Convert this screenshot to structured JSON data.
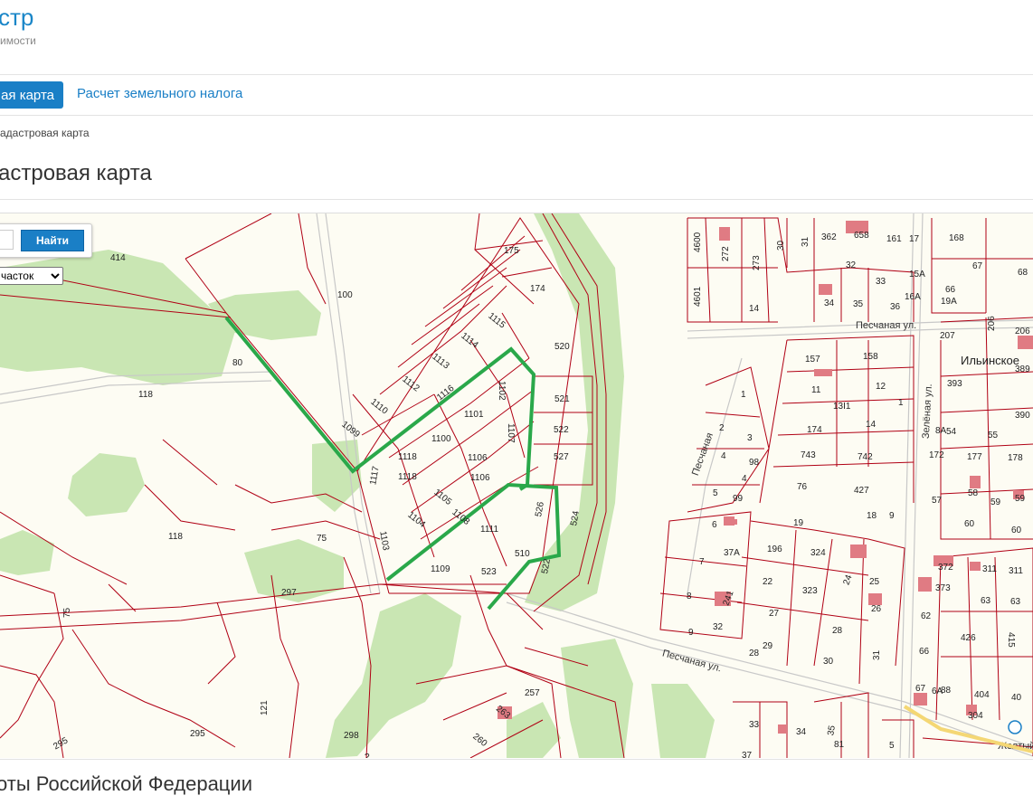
{
  "header": {
    "logo_title": "стр",
    "logo_subtitle": "имости"
  },
  "nav": {
    "active_tab": "ая карта",
    "link_tax": "Расчет земельного налога"
  },
  "breadcrumb": "адастровая карта",
  "page_title": "астровая карта",
  "map_controls": {
    "search_button": "Найти",
    "search_value": "",
    "type_select": "часток"
  },
  "map": {
    "streets": [
      "Песчаная ул.",
      "Песчаная ул.",
      "Зелёная ул.",
      "Песчаная"
    ],
    "place": "Ильинское",
    "transit": "Желтый",
    "parcels": [
      "175",
      "174",
      "100",
      "414",
      "80",
      "118",
      "118",
      "75",
      "297",
      "295",
      "121",
      "298",
      "75",
      "295",
      "1115",
      "1114",
      "1113",
      "1112",
      "1110",
      "1099",
      "1116",
      "1101",
      "1102",
      "1100",
      "1118",
      "1106",
      "1118",
      "1106",
      "1107",
      "1117",
      "1105",
      "1104",
      "1103",
      "1108",
      "1111",
      "1109",
      "523",
      "510",
      "526",
      "524",
      "520",
      "521",
      "522",
      "527",
      "257",
      "263",
      "260",
      "4600",
      "4601",
      "272",
      "273",
      "30",
      "31",
      "14",
      "362",
      "658",
      "161",
      "17",
      "32",
      "33",
      "16А",
      "15А",
      "34",
      "35",
      "36",
      "168",
      "67",
      "68",
      "19А",
      "66",
      "207",
      "206",
      "206",
      "157",
      "158",
      "11",
      "12",
      "13І1",
      "1",
      "393",
      "389",
      "390",
      "2",
      "3",
      "174",
      "14",
      "743",
      "742",
      "4",
      "98",
      "172",
      "177",
      "178",
      "8А",
      "55",
      "54",
      "5",
      "99",
      "76",
      "427",
      "57",
      "58",
      "59",
      "59",
      "60",
      "6",
      "18",
      "9",
      "19",
      "196",
      "324",
      "7",
      "37А",
      "372",
      "311",
      "311",
      "22",
      "323",
      "24",
      "25",
      "373",
      "8",
      "27",
      "26",
      "62",
      "63",
      "241",
      "415",
      "28",
      "32",
      "9",
      "29",
      "426",
      "66",
      "28",
      "30",
      "31",
      "67",
      "404",
      "304",
      "34",
      "33",
      "35",
      "37",
      "81",
      "5",
      "1",
      "88",
      "6А",
      "40"
    ]
  },
  "footer": {
    "title": "оты Российской Федерации"
  },
  "colors": {
    "accent": "#1a7fc6",
    "parcel_border": "#b00014",
    "route": "#2aa84a",
    "vegetation": "#c9e6b3",
    "background": "#fdfcf3",
    "building": "#e07b83"
  }
}
